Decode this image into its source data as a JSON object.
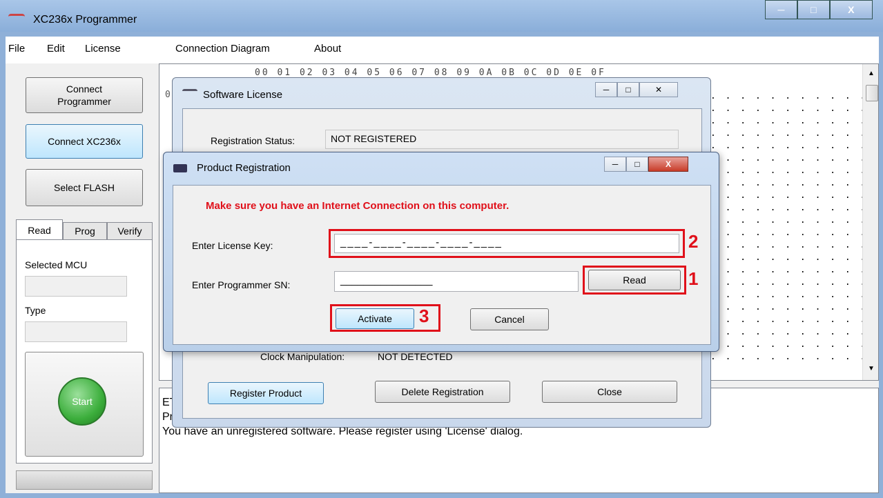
{
  "window": {
    "title": "XC236x Programmer"
  },
  "menu": [
    "File",
    "Edit",
    "License",
    "Connection Diagram",
    "About"
  ],
  "left_panel": {
    "connect_programmer": "Connect\nProgrammer",
    "connect_xc": "Connect XC236x",
    "select_flash": "Select FLASH",
    "tabs": [
      "Read",
      "Prog",
      "Verify"
    ],
    "selected_mcu_label": "Selected MCU",
    "type_label": "Type",
    "start_label": "Start"
  },
  "hex_view": {
    "header": "00 01 02 03 04 05 06 07 08 09 0A 0B 0C 0D 0E 0F",
    "row_prefix": "0",
    "dots_row": ". . . . . . . . . . . . . . . ."
  },
  "log": {
    "line1": "ET",
    "line2": "Pr",
    "line3": "You have an unregistered software. Please register using 'License' dialog."
  },
  "software_license": {
    "title": "Software License",
    "status_label": "Registration Status:",
    "status_value": "NOT REGISTERED",
    "clock_label": "Clock Manipulation:",
    "clock_value": "NOT DETECTED",
    "register_button": "Register Product",
    "delete_button": "Delete Registration",
    "close_button": "Close"
  },
  "product_registration": {
    "title": "Product Registration",
    "warning": "Make sure you have an Internet Connection on this computer.",
    "license_key_label": "Enter License Key:",
    "license_key_value": "____-____-____-____-____",
    "programmer_sn_label": "Enter Programmer SN:",
    "programmer_sn_value": "________________",
    "read_button": "Read",
    "activate_button": "Activate",
    "cancel_button": "Cancel",
    "markers": [
      "1",
      "2",
      "3"
    ]
  },
  "colors": {
    "accent_red": "#e0101a",
    "warning_text": "#e0101a",
    "start_green": "#3cae3c"
  }
}
